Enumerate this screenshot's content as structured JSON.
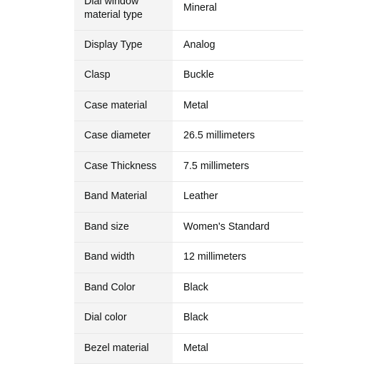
{
  "page": {
    "background_color": "#ffffff",
    "label_column_color": "#f4f4f4",
    "value_column_color": "#ffffff",
    "border_color": "#e7e7e7",
    "text_color": "#0f1111"
  },
  "spec_table": {
    "name": "product-specification-table",
    "rows": [
      {
        "label": "Dial window material type",
        "value": "Mineral"
      },
      {
        "label": "Display Type",
        "value": "Analog"
      },
      {
        "label": "Clasp",
        "value": "Buckle"
      },
      {
        "label": "Case material",
        "value": "Metal"
      },
      {
        "label": "Case diameter",
        "value": "26.5 millimeters"
      },
      {
        "label": "Case Thickness",
        "value": "7.5 millimeters"
      },
      {
        "label": "Band Material",
        "value": "Leather"
      },
      {
        "label": "Band size",
        "value": "Women's Standard"
      },
      {
        "label": "Band width",
        "value": "12 millimeters"
      },
      {
        "label": "Band Color",
        "value": "Black"
      },
      {
        "label": "Dial color",
        "value": "Black"
      },
      {
        "label": "Bezel material",
        "value": "Metal"
      }
    ]
  },
  "scrollbar": {
    "thumb_color": "#7c7c7c",
    "orientation": "vertical"
  }
}
